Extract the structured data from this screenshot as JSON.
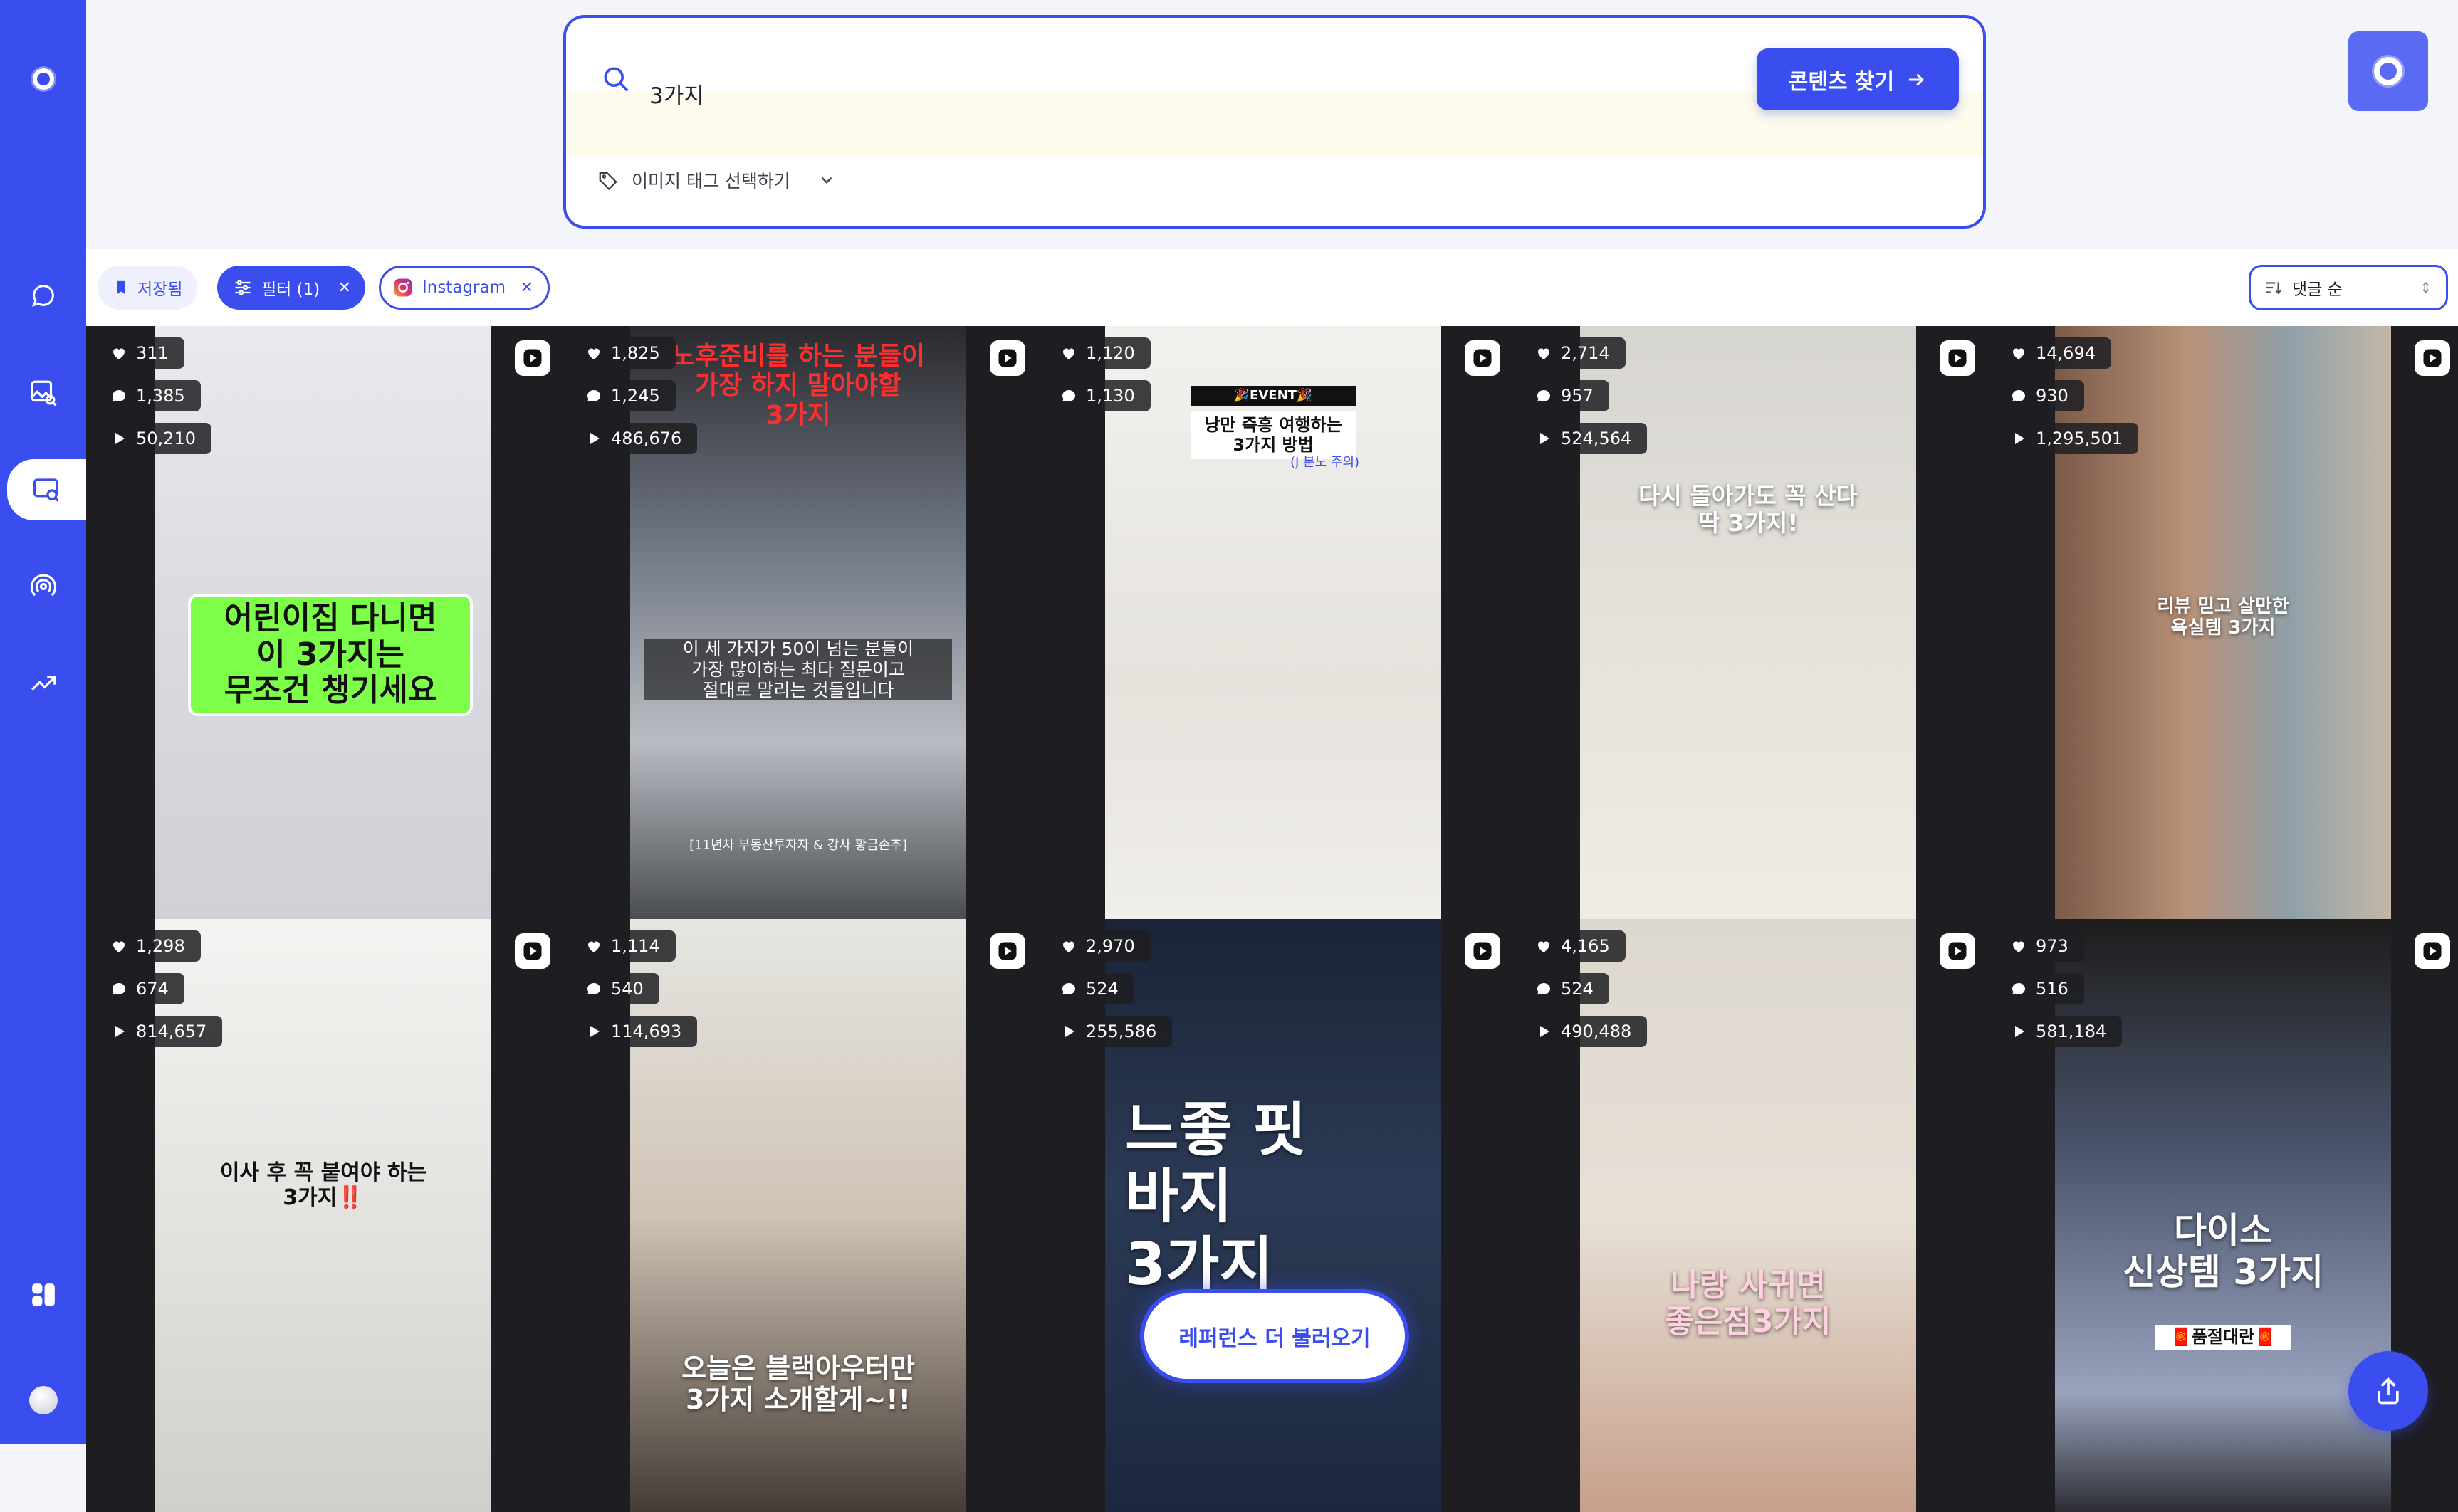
{
  "search": {
    "query": "3가지",
    "button_label": "콘텐츠 찾기",
    "tag_label": "이미지 태그 선택하기"
  },
  "toolbar": {
    "saved_label": "저장됨",
    "filter_label": "필터 (1)",
    "platform_label": "Instagram",
    "sort_label": "댓글 순"
  },
  "load_more_label": "레퍼런스 더 불러오기",
  "colors": {
    "brand": "#3a4ef0",
    "background": "#f4f5fb"
  },
  "icons": [
    "logo-icon",
    "chat-icon",
    "image-search-icon",
    "content-search-icon",
    "podcast-icon",
    "trend-icon",
    "dashboard-icon",
    "user-avatar",
    "search-icon",
    "arrow-right-icon",
    "tag-icon",
    "chevron-down-icon",
    "bookmark-icon",
    "sliders-icon",
    "instagram-icon",
    "close-icon",
    "eye-icon",
    "sort-icon",
    "heart-icon",
    "comment-icon",
    "play-icon",
    "reel-icon",
    "share-icon"
  ],
  "cards": [
    {
      "likes": "311",
      "comments": "1,385",
      "views": "50,210",
      "caption": "어린이집 다니면\n이 3가지는\n무조건 챙기세요"
    },
    {
      "likes": "1,825",
      "comments": "1,245",
      "views": "486,676",
      "caption": "노후준비를 하는 분들이\n가장 하지 말아야할\n3가지",
      "subcaption": "이 세 가지가 50이 넘는 분들이\n가장 많이하는 최다 질문이고\n절대로 말리는 것들입니다",
      "footnote": "[11년차 부동산투자자 & 강사 황금손추]"
    },
    {
      "likes": "1,120",
      "comments": "1,130",
      "views": "",
      "event": "🎉EVENT🎉",
      "caption": "낭만 즉흥 여행하는\n3가지 방법",
      "footnote": "(J 분노 주의)"
    },
    {
      "likes": "2,714",
      "comments": "957",
      "views": "524,564",
      "caption": "다시 돌아가도 꼭 산다\n딱 3가지!"
    },
    {
      "likes": "14,694",
      "comments": "930",
      "views": "1,295,501",
      "caption": "리뷰 믿고 살만한\n욕실템 3가지"
    },
    {
      "likes": "1,298",
      "comments": "674",
      "views": "814,657",
      "caption": "이사 후 꼭 붙여야 하는\n3가지‼️"
    },
    {
      "likes": "1,114",
      "comments": "540",
      "views": "114,693",
      "caption": "오늘은 블랙아우터만\n3가지 소개할게~!!"
    },
    {
      "likes": "2,970",
      "comments": "524",
      "views": "255,586",
      "caption": "느좋 핏\n바지\n3가지"
    },
    {
      "likes": "4,165",
      "comments": "524",
      "views": "490,488",
      "caption": "나랑 사귀면\n좋은점3가지"
    },
    {
      "likes": "973",
      "comments": "516",
      "views": "581,184",
      "caption": "다이소\n신상템 3가지",
      "badge": "🧧품절대란🧧"
    }
  ]
}
